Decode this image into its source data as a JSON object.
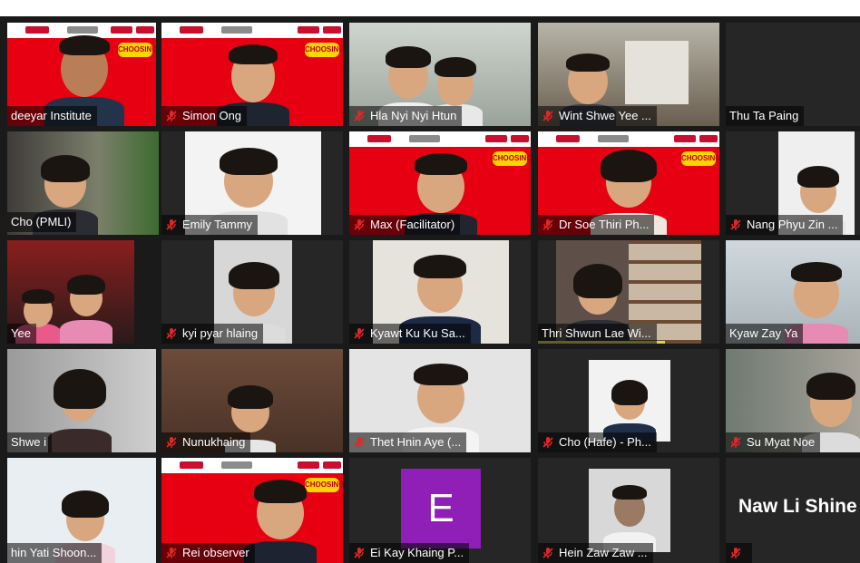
{
  "participants": [
    {
      "name": "deeyar Institute",
      "muted": false
    },
    {
      "name": "Simon Ong",
      "muted": true
    },
    {
      "name": "Hla Nyi Nyi Htun",
      "muted": true
    },
    {
      "name": "Wint Shwe Yee ...",
      "muted": true
    },
    {
      "name": "Thu Ta Paing",
      "muted": false
    },
    {
      "name": "Cho (PMLI)",
      "muted": false
    },
    {
      "name": "Emily Tammy",
      "muted": true
    },
    {
      "name": "Max (Facilitator)",
      "muted": true
    },
    {
      "name": "Dr Soe Thiri Ph...",
      "muted": true
    },
    {
      "name": "Nang Phyu Zin ...",
      "muted": true
    },
    {
      "name": "Yee",
      "muted": false
    },
    {
      "name": "kyi pyar hlaing",
      "muted": true
    },
    {
      "name": "Kyawt Ku Ku Sa...",
      "muted": true
    },
    {
      "name": "Thri Shwun Lae Wi...",
      "muted": false
    },
    {
      "name": "Kyaw Zay Ya",
      "muted": false
    },
    {
      "name": "Shwe i",
      "muted": false
    },
    {
      "name": "Nunukhaing",
      "muted": true
    },
    {
      "name": "Thet Hnin Aye (...",
      "muted": true
    },
    {
      "name": "Cho (Hafe) - Ph...",
      "muted": true
    },
    {
      "name": "Su Myat Noe",
      "muted": true
    },
    {
      "name": "hin Yati Shoon...",
      "muted": false
    },
    {
      "name": "Rei observer",
      "muted": true
    },
    {
      "name": "Ei Kay Khaing P...",
      "muted": true
    },
    {
      "name": "Hein Zaw Zaw ...",
      "muted": true
    },
    {
      "name": "",
      "muted": true
    }
  ],
  "banner_badge": "CHOOSING",
  "avatar_initial": "E",
  "name_card": "Naw Li Shine",
  "colors": {
    "muted_icon": "#e02828",
    "speaker_border": "#d4d84a",
    "avatar_bg": "#8f1fb7",
    "brand_red": "#e60012"
  }
}
